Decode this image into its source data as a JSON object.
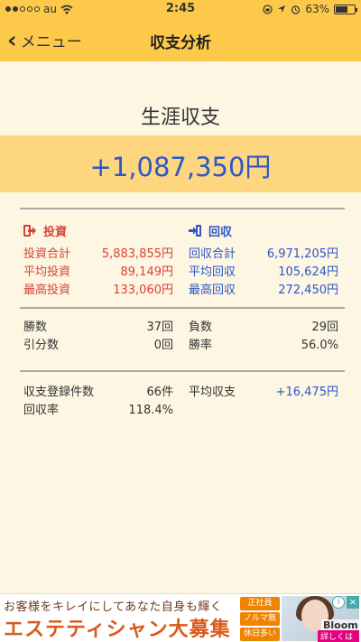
{
  "status_bar": {
    "carrier": "au",
    "time": "2:45",
    "battery": "63%",
    "battery_level": 0.63
  },
  "nav": {
    "back_label": "メニュー",
    "title": "収支分析"
  },
  "summary": {
    "title": "生涯収支",
    "total": "+1,087,350円"
  },
  "investment": {
    "header": "投資",
    "rows": [
      {
        "label": "投資合計",
        "value": "5,883,855円"
      },
      {
        "label": "平均投資",
        "value": "89,149円"
      },
      {
        "label": "最高投資",
        "value": "133,060円"
      }
    ]
  },
  "recovery": {
    "header": "回収",
    "rows": [
      {
        "label": "回収合計",
        "value": "6,971,205円"
      },
      {
        "label": "平均回収",
        "value": "105,624円"
      },
      {
        "label": "最高回収",
        "value": "272,450円"
      }
    ]
  },
  "record_left": [
    {
      "label": "勝数",
      "value": "37回"
    },
    {
      "label": "引分数",
      "value": "0回"
    }
  ],
  "record_right": [
    {
      "label": "負数",
      "value": "29回"
    },
    {
      "label": "勝率",
      "value": "56.0%"
    }
  ],
  "stats_left": [
    {
      "label": "収支登録件数",
      "value": "66件"
    },
    {
      "label": "回収率",
      "value": "118.4%"
    }
  ],
  "stats_right": [
    {
      "label": "平均収支",
      "value": "+16,475円"
    }
  ],
  "ad": {
    "line1": "お客様をキレイにしてあなた自身も輝く",
    "line2": "エステティシャン大募集",
    "tags": [
      "正社員",
      "ノルマ無",
      "休日多い"
    ],
    "brand": "Bloom",
    "more": "詳しくはこちら"
  },
  "colors": {
    "accent": "#fcc94a",
    "band": "#fdd67f",
    "background": "#fdf6e3",
    "investment": "#d94334",
    "recovery": "#2d56c8"
  }
}
